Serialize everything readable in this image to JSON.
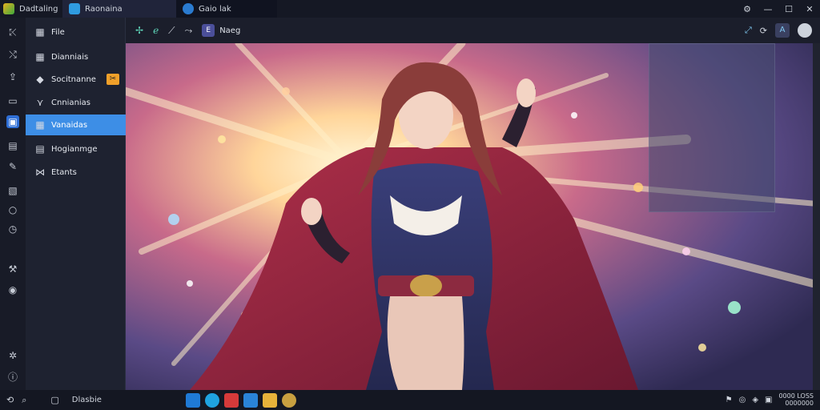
{
  "titlebar": {
    "tabs": [
      {
        "label": "Dadtaling",
        "icon": "app-logo-icon",
        "color": "#e8b020"
      },
      {
        "label": "Raonaina",
        "icon": "chat-icon",
        "color": "#2f9be0"
      },
      {
        "label": "Gaio lak",
        "icon": "globe-icon",
        "color": "#2a7bd0"
      }
    ],
    "controls": [
      "⚙",
      "—",
      "☐",
      "✕"
    ]
  },
  "left_rail": {
    "icons": [
      "collapse-icon",
      "shuffle-icon",
      "share-icon",
      "window-icon",
      "app-icon",
      "photo-icon",
      "key-icon",
      "export-icon",
      "circle-icon",
      "clock-icon",
      "tool-icon",
      "verified-icon",
      "settings-icon",
      "info-icon"
    ],
    "glyphs": [
      "⤪",
      "⤭",
      "⇪",
      "▭",
      "▣",
      "▤",
      "✎",
      "▧",
      "○",
      "◷",
      "⚒",
      "◉",
      "✲",
      "ⓘ"
    ],
    "active_index": 4
  },
  "menu": {
    "items": [
      {
        "label": "File",
        "icon": "file-icon",
        "glyph": "▦"
      },
      {
        "label": "Dianniais",
        "icon": "grid-icon",
        "glyph": "▦"
      },
      {
        "label": "Socitnanne",
        "icon": "bookmark-icon",
        "glyph": "◆",
        "badge": "✂"
      },
      {
        "label": "Cnnianias",
        "icon": "fork-icon",
        "glyph": "⋎"
      },
      {
        "label": "Vanaidas",
        "icon": "folder-icon",
        "glyph": "▦",
        "selected": true
      },
      {
        "label": "Hogianmge",
        "icon": "page-icon",
        "glyph": "▤"
      },
      {
        "label": "Etants",
        "icon": "merge-icon",
        "glyph": "⋈"
      }
    ]
  },
  "toolbar": {
    "icons": [
      "✢",
      "ℯ",
      "⟋",
      "⤳"
    ],
    "file_name": "Naeg",
    "file_icon_glyph": "E",
    "right_icons": [
      "⤢",
      "⟳"
    ],
    "right_square_glyph": "A"
  },
  "taskbar": {
    "left_label": "Dlasbie",
    "left_icons": [
      "⟲",
      "⌕",
      "▢"
    ],
    "apps": [
      {
        "name": "store-app-icon",
        "color": "#1f7ad6"
      },
      {
        "name": "edge-app-icon",
        "color": "#1fa3e0"
      },
      {
        "name": "mail-app-icon",
        "color": "#d63a3a"
      },
      {
        "name": "windows-app-icon",
        "color": "#2a84d8"
      },
      {
        "name": "folder-app-icon",
        "color": "#e6b23a"
      },
      {
        "name": "game-app-icon",
        "color": "#c8a040"
      }
    ],
    "tray": [
      "⚑",
      "◎",
      "◈",
      "▣"
    ],
    "clock_line1": "0000 LOSS",
    "clock_line2": "0000000"
  }
}
